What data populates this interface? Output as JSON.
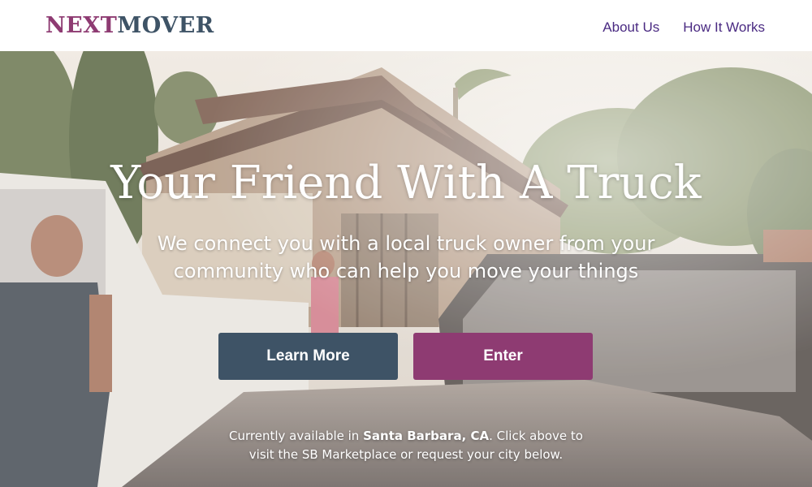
{
  "brand": {
    "logo_part1": "NEXT",
    "logo_part2": "MOVER",
    "color_next": "#8e3b72",
    "color_mover": "#3e5366"
  },
  "nav": {
    "about": "About Us",
    "how": "How It Works"
  },
  "hero": {
    "headline": "Your Friend With A Truck",
    "subhead": "We connect you with a local truck owner from your community who can help you move your things",
    "learn_more": "Learn More",
    "enter": "Enter",
    "availability_prefix": "Currently available in",
    "availability_city": "Santa Barbara, CA",
    "availability_suffix": ". Click above to visit the SB Marketplace or request your city below."
  },
  "colors": {
    "slate": "#3e5366",
    "plum": "#8e3b72",
    "nav_link": "#4a2a82"
  }
}
